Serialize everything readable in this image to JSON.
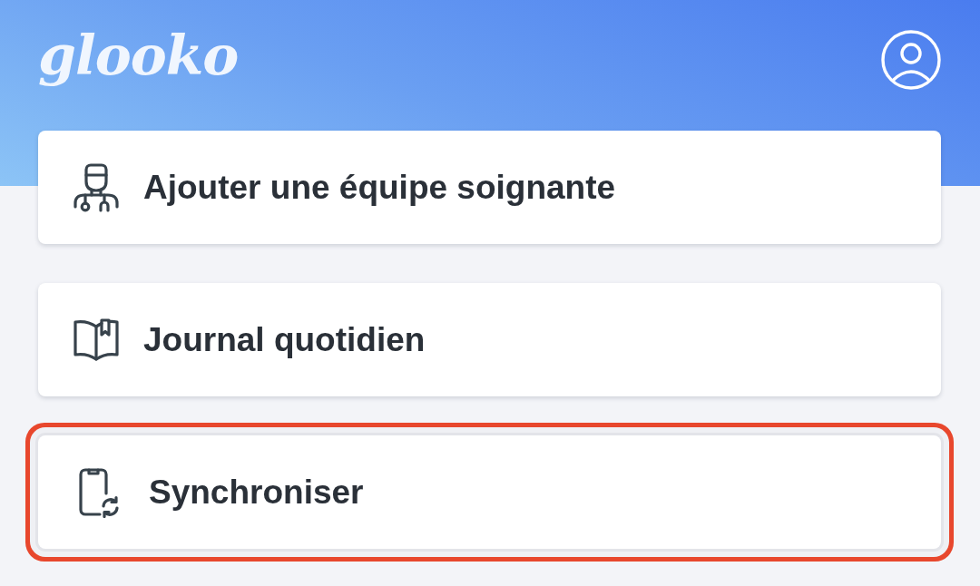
{
  "header": {
    "logo": "glooko"
  },
  "items": [
    {
      "label": "Ajouter une équipe soignante",
      "highlighted": false
    },
    {
      "label": "Journal quotidien",
      "highlighted": false
    },
    {
      "label": "Synchroniser",
      "highlighted": true
    }
  ]
}
